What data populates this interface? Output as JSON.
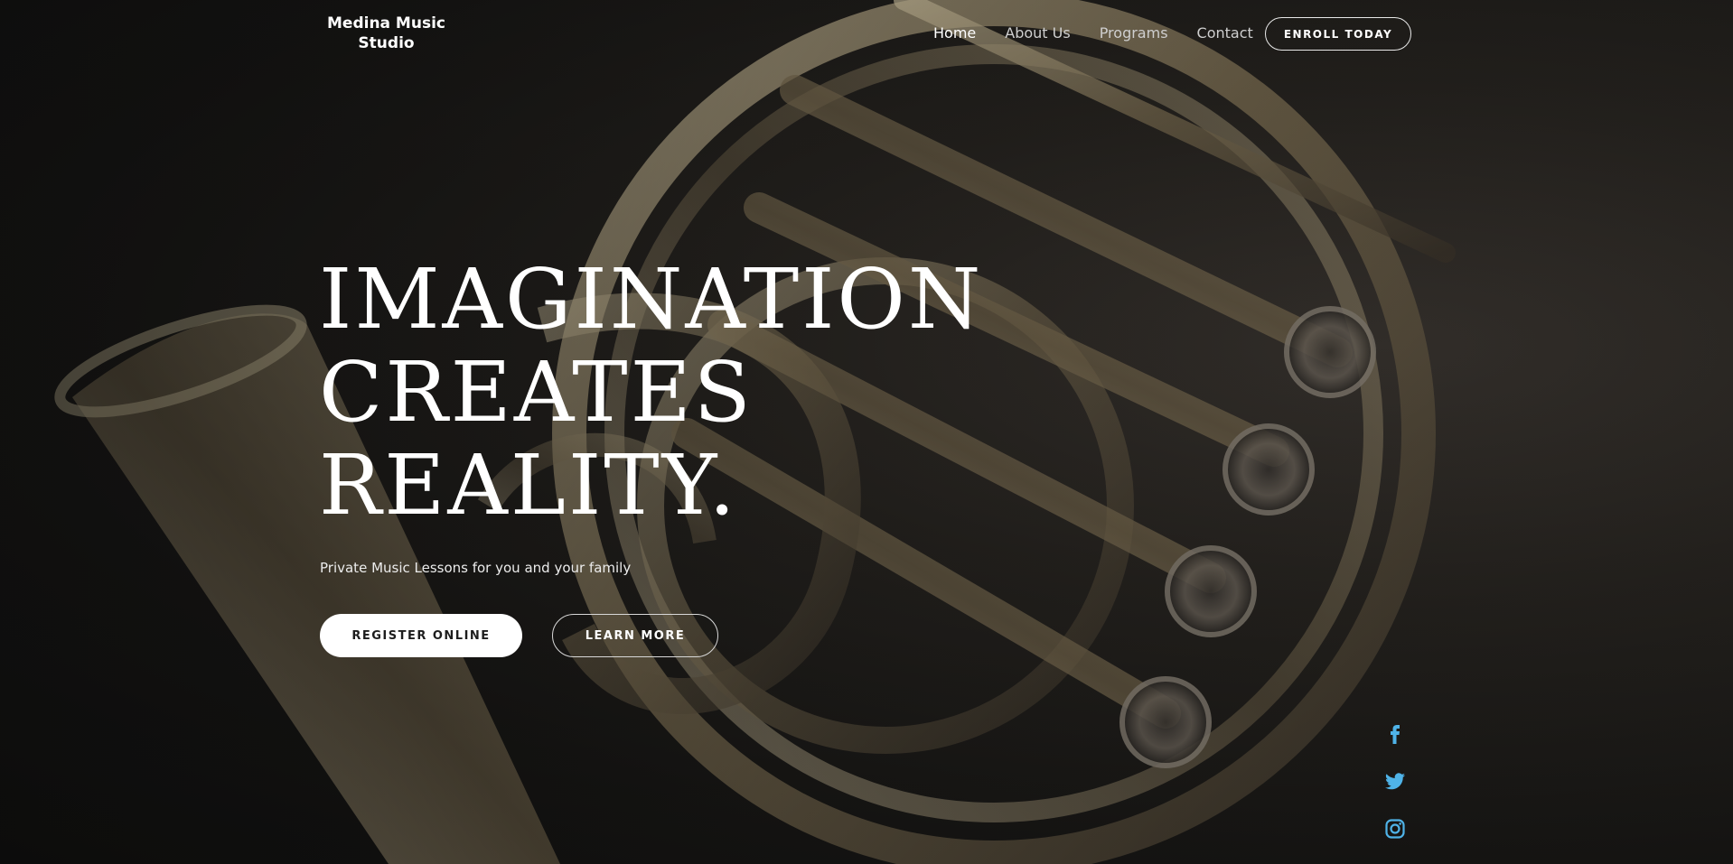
{
  "header": {
    "logo_line1": "Medina Music",
    "logo_line2": "Studio",
    "nav": [
      {
        "label": "Home",
        "active": true
      },
      {
        "label": "About Us",
        "active": false
      },
      {
        "label": "Programs",
        "active": false
      },
      {
        "label": "Contact",
        "active": false
      }
    ],
    "enroll_label": "ENROLL TODAY"
  },
  "hero": {
    "headline_lines": [
      "IMAGINATION",
      "CREATES",
      "REALITY."
    ],
    "subtitle": "Private Music Lessons for you and your family",
    "register_label": "REGISTER ONLINE",
    "learn_label": "LEARN MORE"
  },
  "social": {
    "icons": [
      "facebook-icon",
      "twitter-icon",
      "instagram-icon"
    ],
    "color": "#4fb3e8"
  },
  "colors": {
    "text": "#ffffff",
    "brass": "#b9a77f",
    "background": "#1c1b19"
  }
}
